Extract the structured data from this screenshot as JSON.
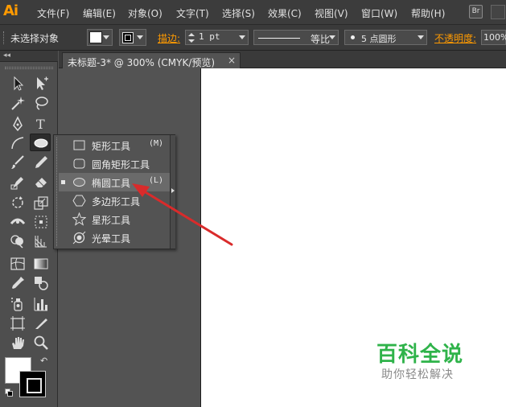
{
  "app": {
    "logo": "Ai",
    "accent": "#ff9a00"
  },
  "menu": {
    "items": [
      {
        "label": "文件(F)"
      },
      {
        "label": "编辑(E)"
      },
      {
        "label": "对象(O)"
      },
      {
        "label": "文字(T)"
      },
      {
        "label": "选择(S)"
      },
      {
        "label": "效果(C)"
      },
      {
        "label": "视图(V)"
      },
      {
        "label": "窗口(W)"
      },
      {
        "label": "帮助(H)"
      }
    ],
    "bridge_label": "Br"
  },
  "control": {
    "selection_status": "未选择对象",
    "fill_color": "#ffffff",
    "stroke_label": "描边:",
    "stroke_weight": "1 pt",
    "profile_label": "等比",
    "brush_label": "5 点圆形",
    "opacity_label": "不透明度:",
    "opacity_value": "100%"
  },
  "document": {
    "tab_title": "未标题-3* @ 300% (CMYK/预览)",
    "close_glyph": "×"
  },
  "tools": {
    "collapse_glyph": "◂◂",
    "swap_glyph": "↶",
    "fill": "#ffffff",
    "stroke": "#000000",
    "items": [
      "selection-tool",
      "direct-selection-tool",
      "magic-wand-tool",
      "lasso-tool",
      "pen-tool",
      "type-tool",
      "line-segment-tool",
      "ellipse-tool",
      "paintbrush-tool",
      "pencil-tool",
      "blob-brush-tool",
      "eraser-tool",
      "rotate-tool",
      "scale-tool",
      "width-tool",
      "free-transform-tool",
      "shape-builder-tool",
      "perspective-grid-tool",
      "mesh-tool",
      "gradient-tool",
      "eyedropper-tool",
      "blend-tool",
      "symbol-sprayer-tool",
      "column-graph-tool",
      "artboard-tool",
      "slice-tool",
      "hand-tool",
      "zoom-tool"
    ],
    "type_tool_glyph": "T"
  },
  "flyout": {
    "items": [
      {
        "label": "矩形工具",
        "shortcut": "(M)",
        "icon": "rectangle-icon",
        "selected": false
      },
      {
        "label": "圆角矩形工具",
        "shortcut": "",
        "icon": "rounded-rectangle-icon",
        "selected": false
      },
      {
        "label": "椭圆工具",
        "shortcut": "(L)",
        "icon": "ellipse-icon",
        "selected": true
      },
      {
        "label": "多边形工具",
        "shortcut": "",
        "icon": "polygon-icon",
        "selected": false
      },
      {
        "label": "星形工具",
        "shortcut": "",
        "icon": "star-icon",
        "selected": false
      },
      {
        "label": "光晕工具",
        "shortcut": "",
        "icon": "flare-icon",
        "selected": false
      }
    ]
  },
  "annotation": {
    "color": "#d92b2b"
  },
  "watermark": {
    "title": "百科全说",
    "subtitle": "助你轻松解决",
    "title_color": "#2fb34a"
  }
}
